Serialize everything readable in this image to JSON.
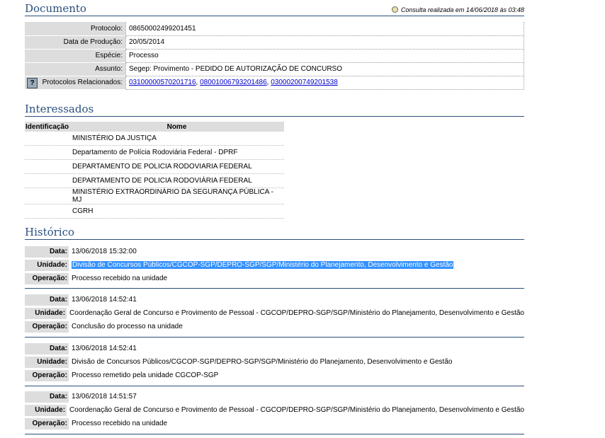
{
  "documento": {
    "title": "Documento",
    "consulta": "Consulta realizada em 14/06/2018 às 03:48",
    "rows": [
      {
        "label": "Protocolo:",
        "value": "08650002499201451"
      },
      {
        "label": "Data de Produção:",
        "value": "20/05/2014"
      },
      {
        "label": "Espécie:",
        "value": "Processo"
      },
      {
        "label": "Assunto:",
        "value": "Segep: Provimento - PEDIDO DE AUTORIZAÇÃO DE CONCURSO"
      }
    ],
    "relacionados": {
      "label": "Protocolos Relacionados:",
      "links": [
        "03100000570201716",
        "08001006793201486",
        "03000200749201538"
      ]
    }
  },
  "interessados": {
    "title": "Interessados",
    "headers": {
      "id": "Identificação",
      "nome": "Nome"
    },
    "rows": [
      "MINISTÉRIO DA JUSTIÇA",
      "Departamento de Polícia Rodoviária Federal - DPRF",
      "DEPARTAMENTO DE POLICIA RODOVIARIA FEDERAL",
      "DEPARTAMENTO DE POLICIA RODOVIÁRIA FEDERAL",
      "MINISTÉRIO EXTRAORDINÁRIO DA SEGURANÇA PÚBLICA - MJ",
      "CGRH"
    ]
  },
  "historico": {
    "title": "Histórico",
    "labels": {
      "data": "Data:",
      "unidade": "Unidade:",
      "operacao": "Operação:"
    },
    "entries": [
      {
        "data": "13/06/2018 15:32:00",
        "unidade": "Divisão de Concursos Públicos/CGCOP-SGP/DEPRO-SGP/SGP/Ministério do Planejamento, Desenvolvimento e Gestão",
        "operacao": "Processo recebido na unidade"
      },
      {
        "data": "13/06/2018 14:52:41",
        "unidade": "Coordenação Geral de Concurso e Provimento de Pessoal - CGCOP/DEPRO-SGP/SGP/Ministério do Planejamento, Desenvolvimento e Gestão",
        "operacao": "Conclusão do processo na unidade"
      },
      {
        "data": "13/06/2018 14:52:41",
        "unidade": "Divisão de Concursos Públicos/CGCOP-SGP/DEPRO-SGP/SGP/Ministério do Planejamento, Desenvolvimento e Gestão",
        "operacao": "Processo remetido pela unidade CGCOP-SGP"
      },
      {
        "data": "13/06/2018 14:51:57",
        "unidade": "Coordenação Geral de Concurso e Provimento de Pessoal - CGCOP/DEPRO-SGP/SGP/Ministério do Planejamento, Desenvolvimento e Gestão",
        "operacao": "Processo recebido na unidade"
      }
    ]
  }
}
